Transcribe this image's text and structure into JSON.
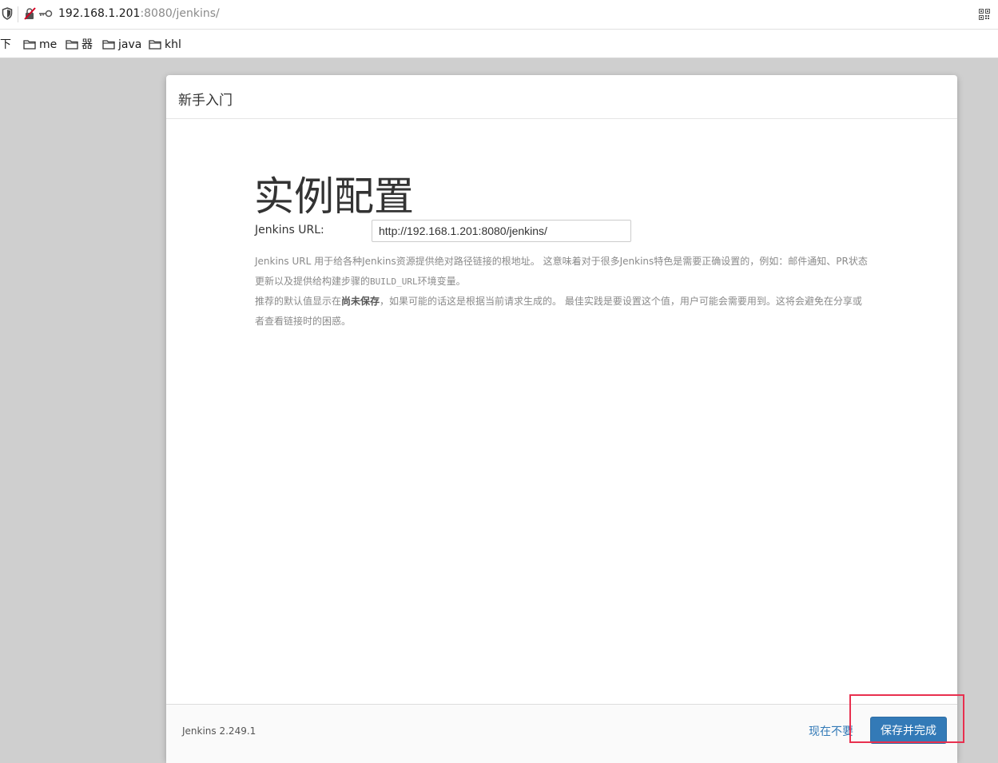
{
  "browser": {
    "url_host": "192.168.1.201",
    "url_path": ":8080/jenkins/",
    "bookmarks": [
      "下",
      "me",
      "器",
      "java",
      "khl"
    ]
  },
  "dialog": {
    "header_title": "新手入门",
    "page_title": "实例配置",
    "url_label": "Jenkins URL:",
    "url_value": "http://192.168.1.201:8080/jenkins/",
    "help_line1_text": "Jenkins URL 用于给各种Jenkins资源提供绝对路径链接的根地址。 这意味着对于很多Jenkins特色是需要正确设置的，例如：邮件通知、PR状态更新以及提供给构建步骤的",
    "help_line1_code": "BUILD_URL",
    "help_line1_tail": "环境变量。",
    "help_line2_pre": "推荐的默认值显示在",
    "help_line2_bold": "尚未保存",
    "help_line2_post": "，如果可能的话这是根据当前请求生成的。 最佳实践是要设置这个值，用户可能会需要用到。这将会避免在分享或者查看链接时的困惑。",
    "version": "Jenkins 2.249.1",
    "skip_label": "现在不要",
    "save_label": "保存并完成"
  },
  "colors": {
    "primary": "#337ab7",
    "highlight": "#e8304f"
  }
}
